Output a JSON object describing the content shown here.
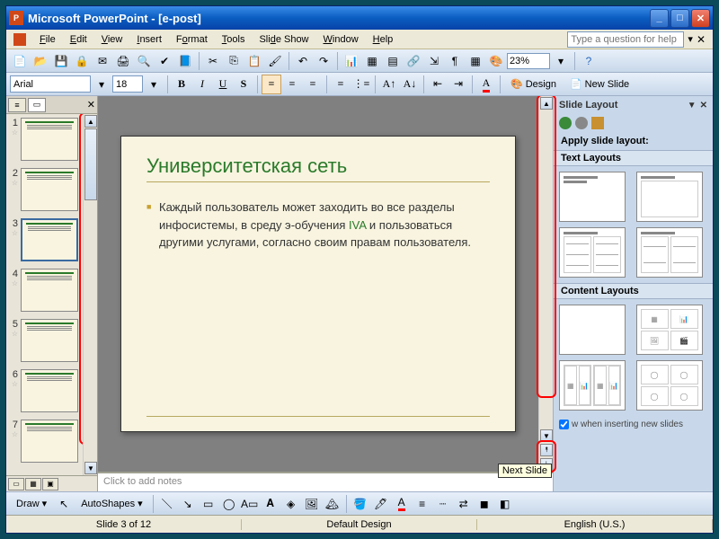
{
  "title": "Microsoft PowerPoint - [e-post]",
  "menus": {
    "file": "File",
    "edit": "Edit",
    "view": "View",
    "insert": "Insert",
    "format": "Format",
    "tools": "Tools",
    "slideshow": "Slide Show",
    "window": "Window",
    "help": "Help"
  },
  "help_placeholder": "Type a question for help",
  "zoom": "23%",
  "font": {
    "name": "Arial",
    "size": "18"
  },
  "design_btn": "Design",
  "newslide_btn": "New Slide",
  "slide": {
    "title": "Университетская сеть",
    "body": "Каждый пользователь может заходить во все разделы инфосистемы, в среду э-обучения ",
    "link": "IVA",
    "body2": " и пользоваться другими услугами, согласно своим правам пользователя."
  },
  "notes_placeholder": "Click to add notes",
  "taskpane": {
    "title": "Slide Layout",
    "apply": "Apply slide layout:",
    "section1": "Text Layouts",
    "section2": "Content Layouts",
    "footer": "w when inserting new slides"
  },
  "tooltip_next": "Next Slide",
  "draw_label": "Draw",
  "autoshapes": "AutoShapes",
  "status": {
    "slide": "Slide 3 of 12",
    "design": "Default Design",
    "lang": "English (U.S.)"
  },
  "thumb_count": 7
}
